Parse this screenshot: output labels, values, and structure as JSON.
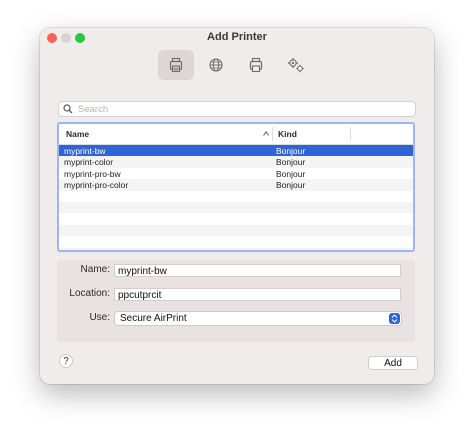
{
  "window": {
    "title": "Add Printer"
  },
  "toolbar": {
    "items": [
      {
        "icon": "default-printer-icon",
        "active": true
      },
      {
        "icon": "ip-globe-icon",
        "active": false
      },
      {
        "icon": "windows-printer-icon",
        "active": false
      },
      {
        "icon": "advanced-gears-icon",
        "active": false
      }
    ]
  },
  "search": {
    "placeholder": "Search",
    "value": ""
  },
  "table": {
    "columns": [
      "Name",
      "Kind"
    ],
    "sort": {
      "column": "Name",
      "direction": "ascending"
    },
    "rows": [
      {
        "name": "myprint-bw",
        "kind": "Bonjour",
        "selected": true
      },
      {
        "name": "myprint-color",
        "kind": "Bonjour",
        "selected": false
      },
      {
        "name": "myprint-pro-bw",
        "kind": "Bonjour",
        "selected": false
      },
      {
        "name": "myprint-pro-color",
        "kind": "Bonjour",
        "selected": false
      }
    ]
  },
  "form": {
    "name_label": "Name:",
    "name_value": "myprint-bw",
    "location_label": "Location:",
    "location_value": "ppcutprcit",
    "use_label": "Use:",
    "use_value": "Secure AirPrint"
  },
  "footer": {
    "help_label": "?",
    "add_label": "Add"
  },
  "colors": {
    "selection": "#2f63d8",
    "focus_ring": "#9bb6f2"
  }
}
